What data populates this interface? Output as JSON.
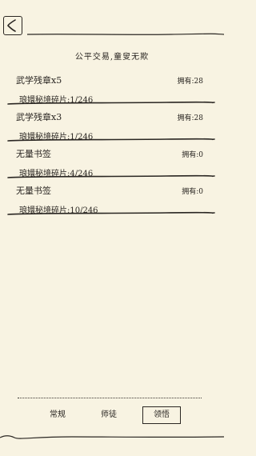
{
  "header": {
    "title": "公平交易,童叟无欺",
    "back_icon": "back-arrow-icon"
  },
  "trades": [
    {
      "reward": "武学残章x5",
      "owned": "拥有:28",
      "cost": "琅嬛秘境碎片:1/246"
    },
    {
      "reward": "武学残章x3",
      "owned": "拥有:28",
      "cost": "琅嬛秘境碎片:1/246"
    },
    {
      "reward": "无量书签",
      "owned": "拥有:0",
      "cost": "琅嬛秘境碎片:4/246"
    },
    {
      "reward": "无量书签",
      "owned": "拥有:0",
      "cost": "琅嬛秘境碎片:10/246"
    }
  ],
  "tabs": [
    {
      "label": "常规"
    },
    {
      "label": "师徒"
    },
    {
      "label": "领悟",
      "selected": true
    }
  ]
}
